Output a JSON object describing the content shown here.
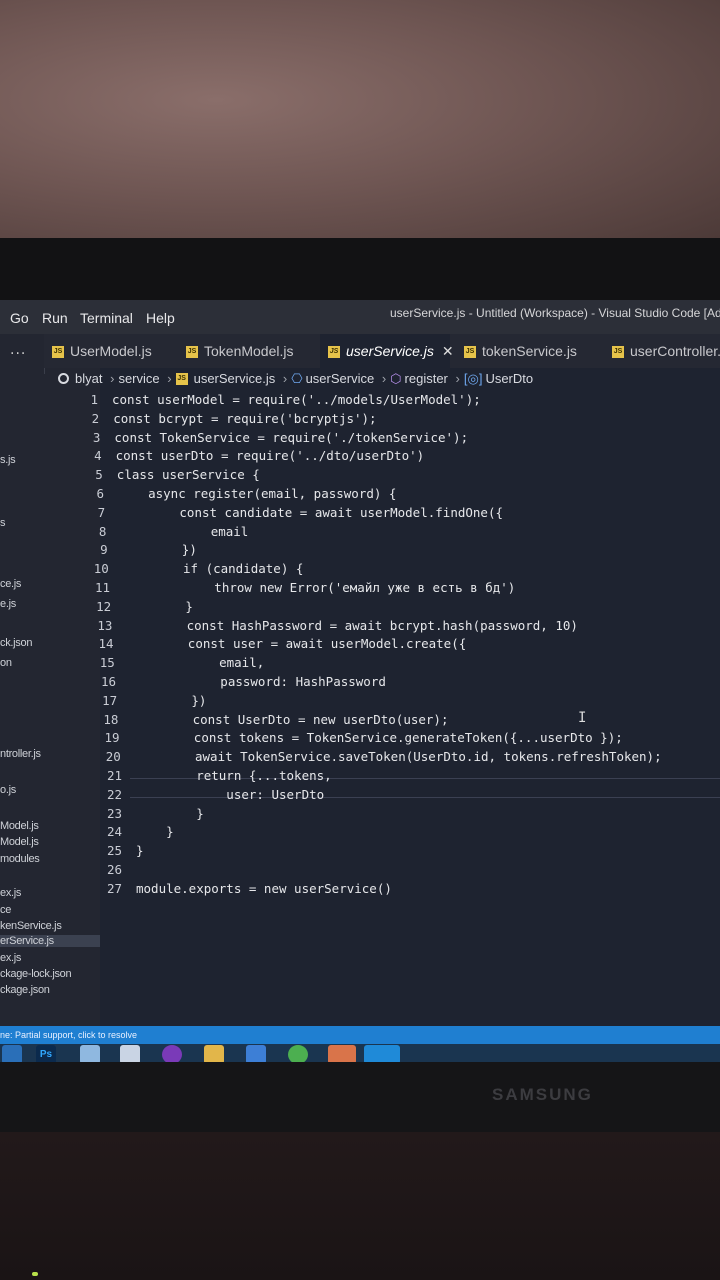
{
  "menu": {
    "go": "Go",
    "run": "Run",
    "terminal": "Terminal",
    "help": "Help",
    "window_title": "userService.js - Untitled (Workspace) - Visual Studio Code [Ad"
  },
  "tabs": [
    {
      "label": "UserModel.js"
    },
    {
      "label": "TokenModel.js"
    },
    {
      "label": "userService.js"
    },
    {
      "label": "tokenService.js"
    },
    {
      "label": "userController.js"
    }
  ],
  "explorer": {
    "more": "...",
    "items": [
      "s.js",
      "s",
      "ce.js",
      "e.js",
      "ck.json",
      "on",
      "ntroller.js",
      "o.js",
      "Model.js",
      "Model.js",
      "modules",
      "ex.js",
      "ce",
      "kenService.js",
      "erService.js",
      "ex.js",
      "ckage-lock.json",
      "ckage.json"
    ]
  },
  "breadcrumb": [
    "blyat",
    "service",
    "userService.js",
    "userService",
    "register",
    "UserDto"
  ],
  "code": [
    {
      "n": "1",
      "t": "const userModel = require('../models/UserModel');"
    },
    {
      "n": "2",
      "t": "const bcrypt = require('bcryptjs');"
    },
    {
      "n": "3",
      "t": "const TokenService = require('./tokenService');"
    },
    {
      "n": "4",
      "t": "const userDto = require('../dto/userDto')"
    },
    {
      "n": "5",
      "t": "class userService {"
    },
    {
      "n": "6",
      "t": "    async register(email, password) {"
    },
    {
      "n": "7",
      "t": "        const candidate = await userModel.findOne({"
    },
    {
      "n": "8",
      "t": "            email"
    },
    {
      "n": "9",
      "t": "        })"
    },
    {
      "n": "10",
      "t": "        if (candidate) {"
    },
    {
      "n": "11",
      "t": "            throw new Error('емайл уже в есть в бд')"
    },
    {
      "n": "12",
      "t": "        }"
    },
    {
      "n": "13",
      "t": "        const HashPassword = await bcrypt.hash(password, 10)"
    },
    {
      "n": "14",
      "t": "        const user = await userModel.create({"
    },
    {
      "n": "15",
      "t": "            email,"
    },
    {
      "n": "16",
      "t": "            password: HashPassword"
    },
    {
      "n": "17",
      "t": "        })"
    },
    {
      "n": "18",
      "t": "        const UserDto = new userDto(user);"
    },
    {
      "n": "19",
      "t": "        const tokens = TokenService.generateToken({...userDto });"
    },
    {
      "n": "20",
      "t": "        await TokenService.saveToken(UserDto.id, tokens.refreshToken);"
    },
    {
      "n": "21",
      "t": "        return {...tokens,"
    },
    {
      "n": "22",
      "t": "            user: UserDto"
    },
    {
      "n": "23",
      "t": "        }"
    },
    {
      "n": "24",
      "t": "    }"
    },
    {
      "n": "25",
      "t": "}"
    },
    {
      "n": "26",
      "t": ""
    },
    {
      "n": "27",
      "t": "module.exports = new userService()"
    }
  ],
  "status": {
    "text": "ne:    Partial support, click to resolve"
  },
  "taskbar": {
    "ps_label": "Ps"
  },
  "monitor": {
    "brand": "SAMSUNG"
  }
}
